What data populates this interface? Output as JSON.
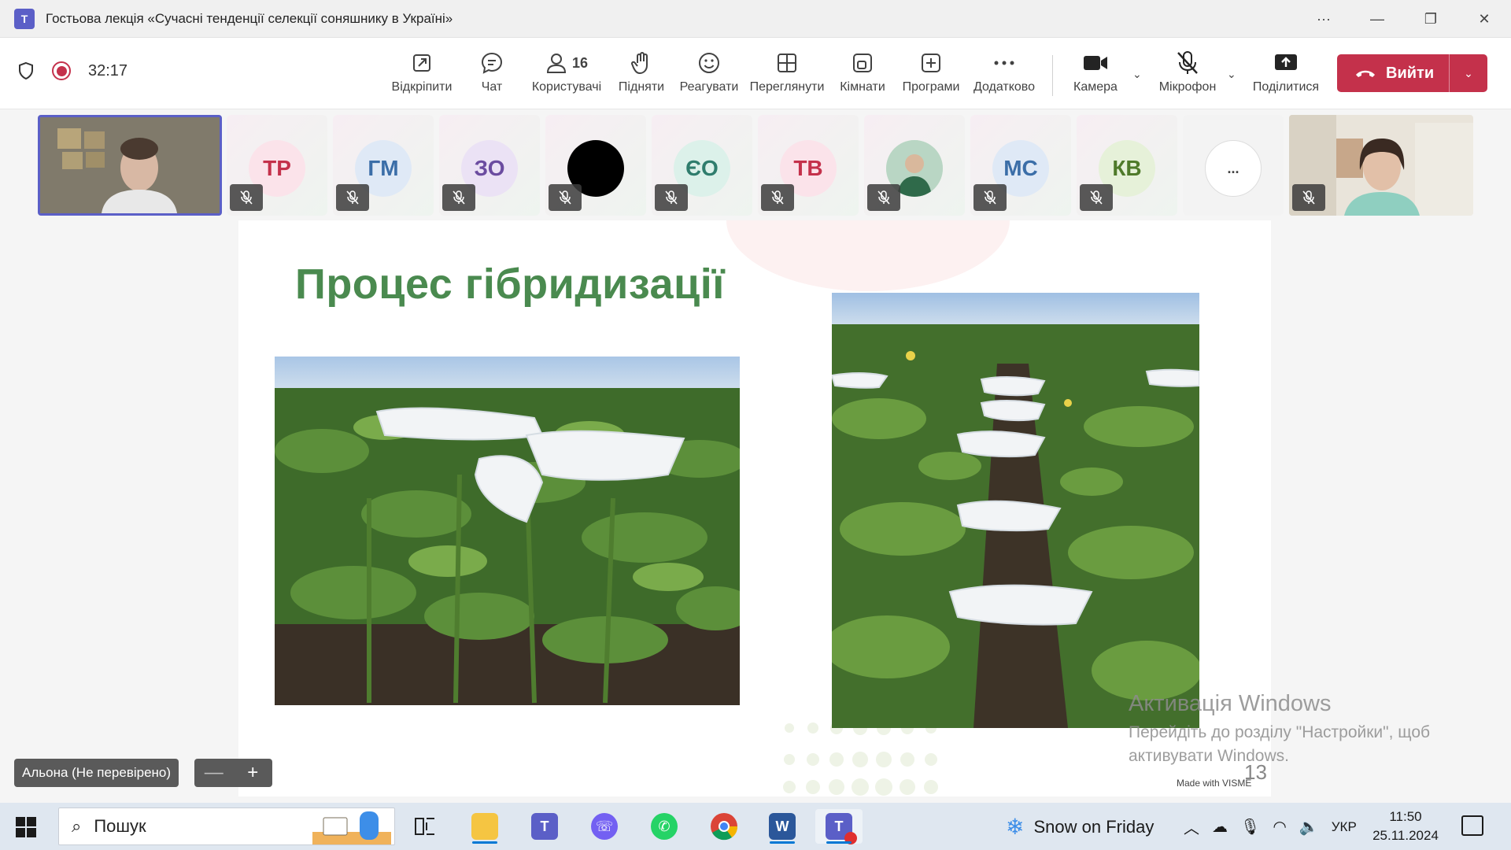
{
  "window": {
    "title": "Гостьова лекція «Сучасні тенденції селекції соняшнику в Україні»",
    "controls": [
      "···",
      "—",
      "❐",
      "✕"
    ]
  },
  "meeting": {
    "timer": "32:17",
    "toolbar": [
      {
        "label": "Відкріпити",
        "icon": "unpin-icon"
      },
      {
        "label": "Чат",
        "icon": "chat-icon"
      },
      {
        "label": "Користувачі",
        "icon": "people-icon",
        "count": "16"
      },
      {
        "label": "Підняти",
        "icon": "raise-hand-icon"
      },
      {
        "label": "Реагувати",
        "icon": "react-icon"
      },
      {
        "label": "Переглянути",
        "icon": "view-icon"
      },
      {
        "label": "Кімнати",
        "icon": "rooms-icon"
      },
      {
        "label": "Програми",
        "icon": "apps-icon"
      },
      {
        "label": "Додатково",
        "icon": "more-icon"
      },
      {
        "label": "Камера",
        "icon": "camera-icon"
      },
      {
        "label": "Мікрофон",
        "icon": "mic-off-icon"
      },
      {
        "label": "Поділитися",
        "icon": "share-icon"
      }
    ],
    "leave_label": "Вийти",
    "accent": "#5b5fc7",
    "leave_color": "#c4314b"
  },
  "participants": [
    {
      "initials": "ТР",
      "color": "#c4314b",
      "bg": "#fbe3ea"
    },
    {
      "initials": "ГМ",
      "color": "#3b6ea8",
      "bg": "#dfe9f6"
    },
    {
      "initials": "ЗО",
      "color": "#6b4ca0",
      "bg": "#ebe2f5"
    },
    {
      "initials": "",
      "color": "#000000",
      "bg": "#000000"
    },
    {
      "initials": "ЄО",
      "color": "#2f7d6d",
      "bg": "#dcf1ea"
    },
    {
      "initials": "ТВ",
      "color": "#c4314b",
      "bg": "#fbe3ea"
    },
    {
      "initials": "",
      "color": "#333333",
      "bg": "#cfe3d0"
    },
    {
      "initials": "МС",
      "color": "#3b6ea8",
      "bg": "#dfe9f6"
    },
    {
      "initials": "КВ",
      "color": "#4f7a2a",
      "bg": "#e6f1d9"
    },
    {
      "initials": "...",
      "color": "#424242",
      "bg": "#ffffff"
    }
  ],
  "slide": {
    "title": "Процес гібридизації",
    "number": "13",
    "made_with": "Made with VISME"
  },
  "activation": {
    "title": "Активація Windows",
    "subtitle": "Перейдіть до розділу \"Настройки\", щоб активувати Windows."
  },
  "presenter": {
    "name_tag": "Альона (Не перевірено)",
    "zoom_out": "—",
    "zoom_in": "+"
  },
  "taskbar": {
    "search_placeholder": "Пошук",
    "weather": "Snow on Friday",
    "language": "УКР",
    "time": "11:50",
    "date": "25.11.2024"
  }
}
